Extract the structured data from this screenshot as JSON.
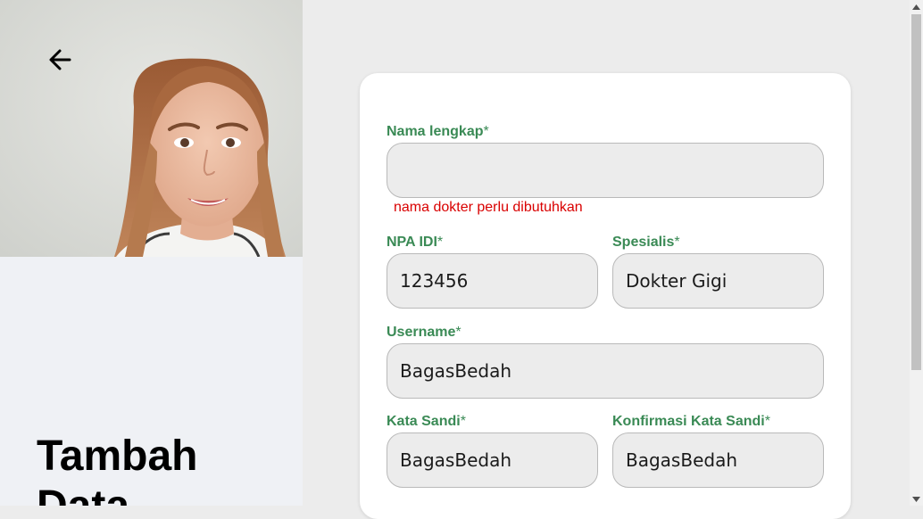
{
  "header": {
    "back_icon": "arrow-left-icon",
    "title": "Tambah Data"
  },
  "form": {
    "full_name": {
      "label": "Nama lengkap",
      "required_mark": "*",
      "value": "",
      "error": "nama dokter perlu dibutuhkan"
    },
    "npa_idi": {
      "label": "NPA IDI",
      "required_mark": "*",
      "value": "123456"
    },
    "specialist": {
      "label": "Spesialis",
      "required_mark": "*",
      "value": "Dokter Gigi"
    },
    "username": {
      "label": "Username",
      "required_mark": "*",
      "value": "BagasBedah"
    },
    "password": {
      "label": "Kata Sandi",
      "required_mark": "*",
      "value": "BagasBedah"
    },
    "confirm_password": {
      "label": "Konfirmasi Kata Sandi",
      "required_mark": "*",
      "value": "BagasBedah"
    }
  },
  "colors": {
    "label_green": "#3a8a55",
    "error_red": "#d90000",
    "input_bg": "#ececec",
    "page_bg": "#ececec",
    "left_panel_bg": "#eff1f5"
  }
}
